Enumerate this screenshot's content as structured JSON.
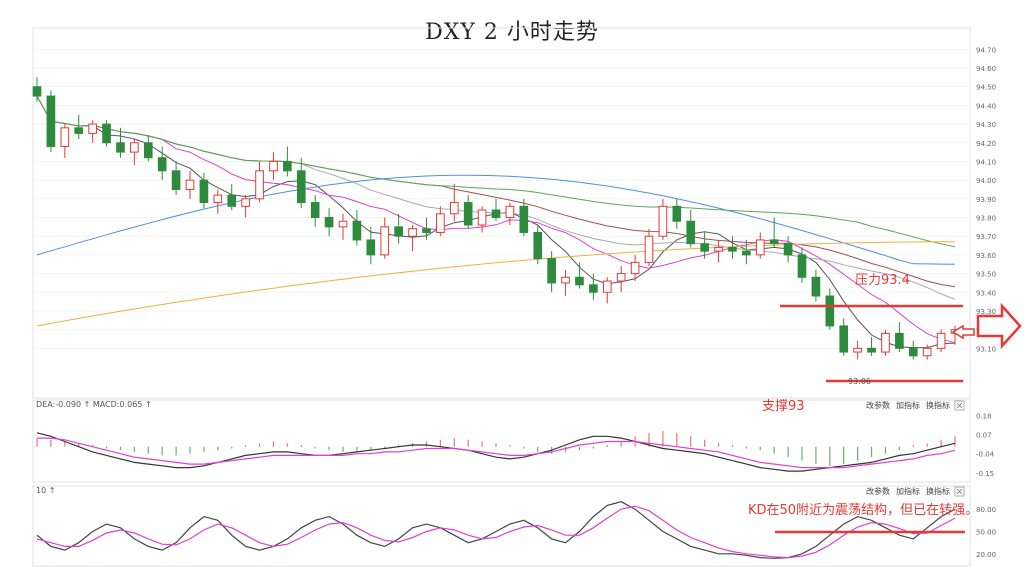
{
  "title": "DXY 2 小时走势",
  "colors": {
    "up": "#e53935",
    "down": "#2e8b3e",
    "ma5": "#555555",
    "ma10": "#e040d0",
    "ma20": "#aaaaaa",
    "ma30": "#a05050",
    "ma60": "#5aa85a",
    "ma120": "#4a90e2",
    "ma250": "#f0b040",
    "annotation": "#e53935",
    "grid": "#eeeeee"
  },
  "chart_data": [
    {
      "type": "candlestick",
      "name": "main",
      "ylim": [
        93.0,
        94.75
      ],
      "y_ticks": [
        "94.70",
        "94.60",
        "94.50",
        "94.40",
        "94.30",
        "94.20",
        "94.10",
        "94.00",
        "93.90",
        "93.80",
        "93.70",
        "93.60",
        "93.50",
        "93.40",
        "93.30",
        "93.20",
        "93.10"
      ],
      "candles": [
        [
          94.5,
          94.55,
          94.42,
          94.45
        ],
        [
          94.45,
          94.48,
          94.15,
          94.18
        ],
        [
          94.18,
          94.3,
          94.12,
          94.28
        ],
        [
          94.28,
          94.35,
          94.22,
          94.25
        ],
        [
          94.25,
          94.32,
          94.2,
          94.3
        ],
        [
          94.3,
          94.32,
          94.18,
          94.2
        ],
        [
          94.2,
          94.28,
          94.12,
          94.15
        ],
        [
          94.15,
          94.22,
          94.08,
          94.2
        ],
        [
          94.2,
          94.24,
          94.1,
          94.12
        ],
        [
          94.12,
          94.18,
          94.0,
          94.05
        ],
        [
          94.05,
          94.1,
          93.92,
          93.95
        ],
        [
          93.95,
          94.05,
          93.9,
          94.0
        ],
        [
          94.0,
          94.04,
          93.85,
          93.88
        ],
        [
          93.88,
          93.95,
          93.82,
          93.92
        ],
        [
          93.92,
          93.98,
          93.84,
          93.86
        ],
        [
          93.86,
          93.92,
          93.8,
          93.9
        ],
        [
          93.9,
          94.1,
          93.88,
          94.05
        ],
        [
          94.05,
          94.15,
          94.0,
          94.1
        ],
        [
          94.1,
          94.18,
          94.02,
          94.05
        ],
        [
          94.05,
          94.12,
          93.85,
          93.88
        ],
        [
          93.88,
          93.92,
          93.75,
          93.8
        ],
        [
          93.8,
          93.85,
          93.7,
          93.75
        ],
        [
          93.75,
          93.82,
          93.68,
          93.78
        ],
        [
          93.78,
          93.84,
          93.65,
          93.68
        ],
        [
          93.68,
          93.75,
          93.55,
          93.6
        ],
        [
          93.6,
          93.8,
          93.58,
          93.75
        ],
        [
          93.75,
          93.82,
          93.66,
          93.7
        ],
        [
          93.7,
          93.76,
          93.62,
          93.74
        ],
        [
          93.74,
          93.8,
          93.68,
          93.72
        ],
        [
          93.72,
          93.86,
          93.7,
          93.82
        ],
        [
          93.82,
          93.98,
          93.78,
          93.88
        ],
        [
          93.88,
          93.92,
          93.74,
          93.76
        ],
        [
          93.76,
          93.86,
          93.72,
          93.84
        ],
        [
          93.84,
          93.9,
          93.78,
          93.8
        ],
        [
          93.8,
          93.88,
          93.76,
          93.86
        ],
        [
          93.86,
          93.9,
          93.7,
          93.72
        ],
        [
          93.72,
          93.76,
          93.55,
          93.58
        ],
        [
          93.58,
          93.62,
          93.4,
          93.45
        ],
        [
          93.45,
          93.52,
          93.38,
          93.48
        ],
        [
          93.48,
          93.56,
          93.42,
          93.44
        ],
        [
          93.44,
          93.5,
          93.36,
          93.4
        ],
        [
          93.4,
          93.48,
          93.34,
          93.46
        ],
        [
          93.46,
          93.54,
          93.4,
          93.5
        ],
        [
          93.5,
          93.6,
          93.46,
          93.56
        ],
        [
          93.56,
          93.74,
          93.54,
          93.7
        ],
        [
          93.7,
          93.9,
          93.68,
          93.86
        ],
        [
          93.86,
          93.9,
          93.74,
          93.78
        ],
        [
          93.78,
          93.84,
          93.64,
          93.66
        ],
        [
          93.66,
          93.72,
          93.58,
          93.62
        ],
        [
          93.62,
          93.68,
          93.56,
          93.64
        ],
        [
          93.64,
          93.7,
          93.58,
          93.62
        ],
        [
          93.62,
          93.68,
          93.55,
          93.6
        ],
        [
          93.6,
          93.72,
          93.58,
          93.68
        ],
        [
          93.68,
          93.8,
          93.64,
          93.66
        ],
        [
          93.66,
          93.7,
          93.56,
          93.6
        ],
        [
          93.6,
          93.64,
          93.45,
          93.48
        ],
        [
          93.48,
          93.52,
          93.35,
          93.38
        ],
        [
          93.38,
          93.42,
          93.2,
          93.22
        ],
        [
          93.22,
          93.26,
          93.06,
          93.08
        ],
        [
          93.08,
          93.14,
          93.04,
          93.1
        ],
        [
          93.1,
          93.16,
          93.06,
          93.08
        ],
        [
          93.08,
          93.2,
          93.06,
          93.18
        ],
        [
          93.18,
          93.24,
          93.08,
          93.1
        ],
        [
          93.1,
          93.14,
          93.04,
          93.06
        ],
        [
          93.06,
          93.12,
          93.04,
          93.1
        ],
        [
          93.1,
          93.2,
          93.08,
          93.18
        ],
        [
          93.18,
          93.22,
          93.12,
          93.2
        ]
      ],
      "price_labels": [
        "93.06"
      ],
      "annotations": [
        "压力93.4",
        "支撑93"
      ]
    },
    {
      "type": "macd",
      "name": "MACD",
      "legend": "DEA:-0.090 ↑ MACD:0.065 ↑",
      "y_ticks": [
        "0.18",
        "0.07",
        "-0.04",
        "-0.15"
      ],
      "ylim": [
        -0.18,
        0.2
      ],
      "hist": [
        0.05,
        0.04,
        0.03,
        0.02,
        0.01,
        -0.01,
        -0.02,
        -0.03,
        -0.04,
        -0.05,
        -0.05,
        -0.04,
        -0.03,
        -0.02,
        -0.01,
        0.01,
        0.02,
        0.03,
        0.02,
        0.01,
        -0.01,
        -0.02,
        -0.03,
        -0.03,
        -0.02,
        -0.01,
        0.01,
        0.02,
        0.03,
        0.04,
        0.05,
        0.04,
        0.03,
        0.02,
        0.01,
        -0.01,
        -0.03,
        -0.04,
        -0.03,
        -0.02,
        -0.01,
        0.01,
        0.03,
        0.06,
        0.08,
        0.09,
        0.08,
        0.06,
        0.04,
        0.02,
        0.01,
        -0.01,
        -0.02,
        -0.04,
        -0.06,
        -0.08,
        -0.1,
        -0.11,
        -0.1,
        -0.08,
        -0.06,
        -0.04,
        -0.02,
        0.01,
        0.02,
        0.04,
        0.06
      ],
      "dif": [
        0.08,
        0.06,
        0.03,
        0.0,
        -0.03,
        -0.05,
        -0.07,
        -0.09,
        -0.1,
        -0.11,
        -0.12,
        -0.12,
        -0.11,
        -0.09,
        -0.07,
        -0.05,
        -0.04,
        -0.03,
        -0.03,
        -0.04,
        -0.05,
        -0.05,
        -0.04,
        -0.03,
        -0.02,
        -0.01,
        0.0,
        0.01,
        0.01,
        0.0,
        -0.01,
        -0.02,
        -0.04,
        -0.06,
        -0.07,
        -0.06,
        -0.04,
        -0.02,
        0.01,
        0.04,
        0.06,
        0.06,
        0.05,
        0.03,
        0.01,
        -0.01,
        -0.02,
        -0.03,
        -0.04,
        -0.06,
        -0.08,
        -0.1,
        -0.12,
        -0.13,
        -0.14,
        -0.14,
        -0.13,
        -0.12,
        -0.11,
        -0.1,
        -0.09,
        -0.07,
        -0.05,
        -0.04,
        -0.02,
        0.0,
        0.02
      ],
      "dea": [
        0.05,
        0.05,
        0.04,
        0.02,
        0.0,
        -0.02,
        -0.04,
        -0.06,
        -0.07,
        -0.08,
        -0.09,
        -0.1,
        -0.1,
        -0.09,
        -0.08,
        -0.07,
        -0.06,
        -0.05,
        -0.05,
        -0.05,
        -0.05,
        -0.05,
        -0.05,
        -0.04,
        -0.04,
        -0.03,
        -0.03,
        -0.02,
        -0.01,
        -0.01,
        -0.01,
        -0.02,
        -0.03,
        -0.04,
        -0.05,
        -0.05,
        -0.04,
        -0.03,
        -0.01,
        0.01,
        0.02,
        0.03,
        0.03,
        0.03,
        0.02,
        0.01,
        0.0,
        -0.01,
        -0.02,
        -0.03,
        -0.05,
        -0.07,
        -0.09,
        -0.1,
        -0.11,
        -0.12,
        -0.12,
        -0.12,
        -0.12,
        -0.11,
        -0.1,
        -0.09,
        -0.08,
        -0.07,
        -0.05,
        -0.04,
        -0.02
      ]
    },
    {
      "type": "line",
      "name": "KD",
      "legend": "10 ↑",
      "y_ticks": [
        "80.00",
        "50.00",
        "20.00"
      ],
      "ylim": [
        5,
        95
      ],
      "k": [
        45,
        30,
        25,
        35,
        50,
        60,
        55,
        40,
        30,
        25,
        35,
        55,
        70,
        65,
        45,
        30,
        25,
        30,
        40,
        55,
        65,
        70,
        60,
        45,
        35,
        30,
        40,
        55,
        60,
        55,
        45,
        35,
        40,
        50,
        60,
        65,
        55,
        40,
        35,
        50,
        70,
        85,
        90,
        80,
        65,
        50,
        40,
        30,
        25,
        20,
        20,
        18,
        15,
        14,
        15,
        20,
        30,
        45,
        60,
        70,
        65,
        55,
        45,
        40,
        55,
        70,
        80
      ],
      "d": [
        40,
        35,
        30,
        30,
        38,
        48,
        52,
        48,
        40,
        33,
        32,
        40,
        52,
        60,
        55,
        45,
        35,
        30,
        33,
        42,
        52,
        60,
        62,
        55,
        45,
        38,
        36,
        42,
        50,
        55,
        52,
        45,
        40,
        42,
        50,
        56,
        58,
        52,
        45,
        45,
        55,
        68,
        80,
        84,
        78,
        65,
        52,
        42,
        35,
        28,
        23,
        20,
        18,
        16,
        15,
        17,
        22,
        32,
        45,
        56,
        62,
        60,
        54,
        47,
        48,
        58,
        68
      ],
      "annotation": "KD在50附近为震荡结构，但已在转强。"
    }
  ],
  "toolbar": {
    "params_label": "改参数",
    "add_indicator_label": "加指标",
    "switch_indicator_label": "换指标"
  },
  "icons": {
    "close": "close-icon",
    "arrow": "arrow-right-icon"
  }
}
